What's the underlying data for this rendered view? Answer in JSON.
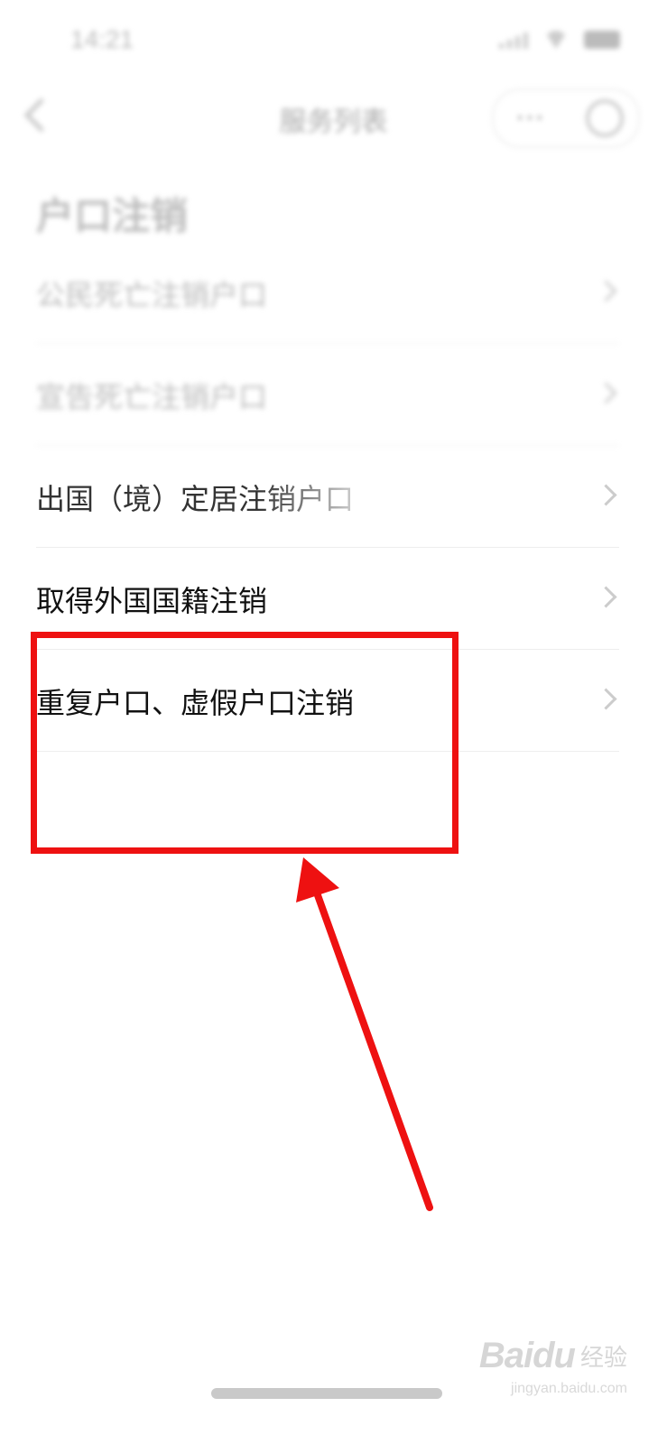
{
  "status_bar": {
    "time": "14:21"
  },
  "nav": {
    "title": "服务列表",
    "more": "···"
  },
  "section": {
    "title": "户口注销"
  },
  "items": [
    {
      "label": "公民死亡注销户口"
    },
    {
      "label": "宣告死亡注销户口"
    },
    {
      "label": "出国（境）定居注销户口"
    },
    {
      "label": "取得外国国籍注销"
    },
    {
      "label": "重复户口、虚假户口注销"
    }
  ],
  "watermark": {
    "logo": "Baidu",
    "text": "经验",
    "url": "jingyan.baidu.com"
  },
  "colors": {
    "highlight": "#ee1111",
    "background": "#ffffff"
  }
}
